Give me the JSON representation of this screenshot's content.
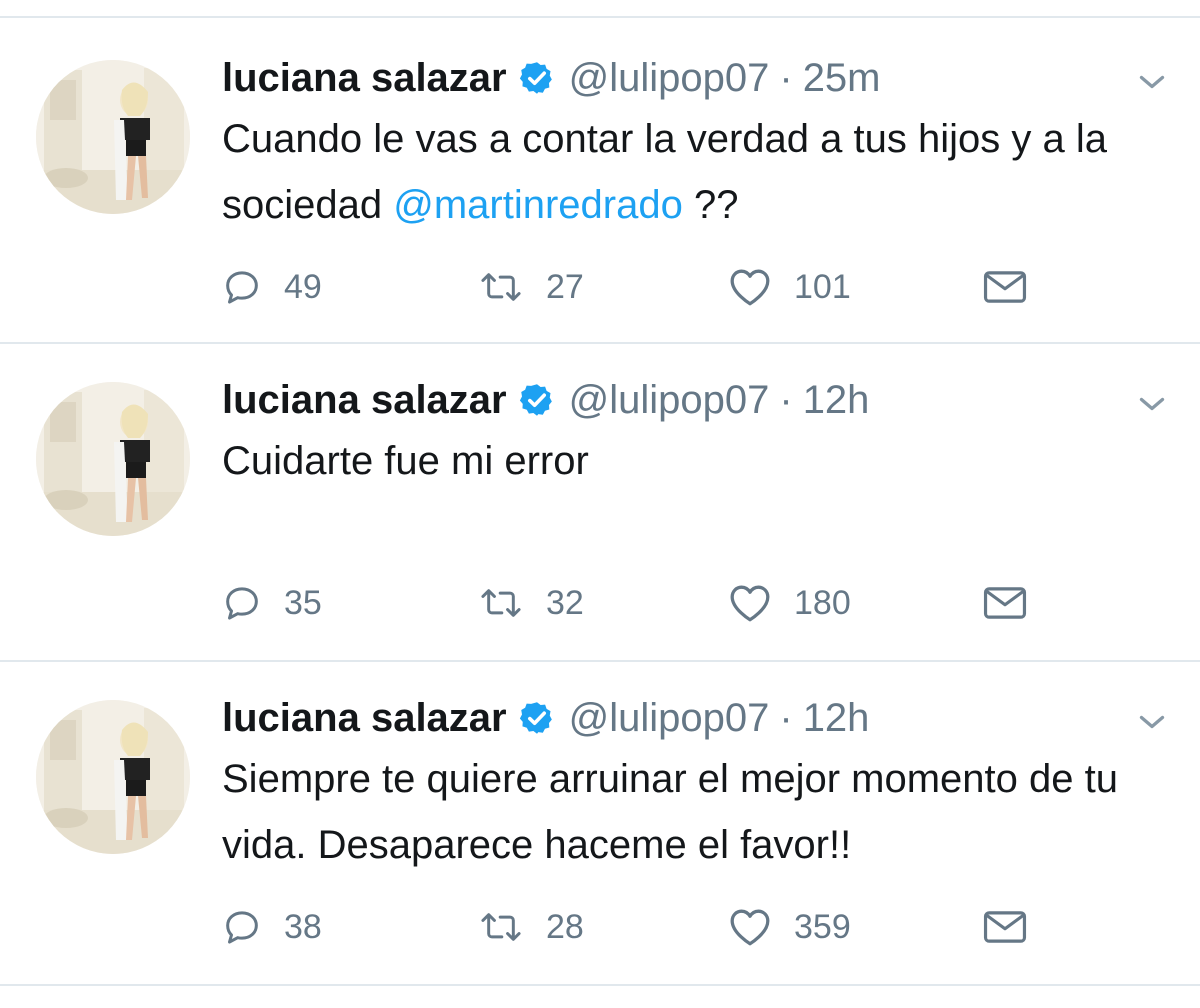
{
  "tweets": [
    {
      "author_name": "luciana salazar",
      "handle": "@lulipop07",
      "separator": "·",
      "time": "25m",
      "text": "Cuando le vas a contar la verdad a tus hijos y a la sociedad ",
      "mention": "@martinredrado",
      "text_after": " ??",
      "replies": "49",
      "retweets": "27",
      "likes": "101"
    },
    {
      "author_name": "luciana salazar",
      "handle": "@lulipop07",
      "separator": "·",
      "time": "12h",
      "text": "Cuidarte fue mi error",
      "replies": "35",
      "retweets": "32",
      "likes": "180"
    },
    {
      "author_name": "luciana salazar",
      "handle": "@lulipop07",
      "separator": "·",
      "time": "12h",
      "text": "Siempre te quiere arruinar el mejor momento de tu vida. Desaparece haceme el favor!!",
      "replies": "38",
      "retweets": "28",
      "likes": "359"
    }
  ],
  "colors": {
    "accent": "#1da1f2",
    "text": "#14171a",
    "secondary": "#657786",
    "divider": "#e1e8ed"
  },
  "icons": {
    "reply": "speech-bubble",
    "retweet": "retweet-arrows",
    "like": "heart-outline",
    "message": "envelope",
    "verified": "verified-badge",
    "menu": "chevron-down"
  }
}
